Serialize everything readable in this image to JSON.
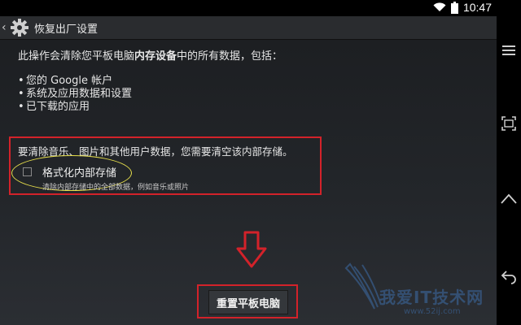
{
  "status": {
    "time": "10:47"
  },
  "header": {
    "title": "恢复出厂设置"
  },
  "content": {
    "intro_prefix": "此操作会清除您平板电脑",
    "intro_bold": "内存设备",
    "intro_suffix": "中的所有数据，包括：",
    "bullets": [
      "您的 Google 帐户",
      "系统及应用数据和设置",
      "已下载的应用"
    ],
    "bullet_mark": "•",
    "notice": "要清除音乐、图片和其他用户数据，您需要清空该内部存储。",
    "option": {
      "label": "格式化内部存储",
      "sublabel": "清除内部存储中的全部数据，例如音乐或照片",
      "checked": false
    },
    "reset_button": "重置平板电脑"
  },
  "watermark": {
    "text": "我爱IT技术网",
    "url": "www.52ij.com"
  },
  "colors": {
    "highlight_red": "#d3222a",
    "ellipse_yellow": "#e8e04c",
    "watermark_blue": "#3d6da8"
  }
}
